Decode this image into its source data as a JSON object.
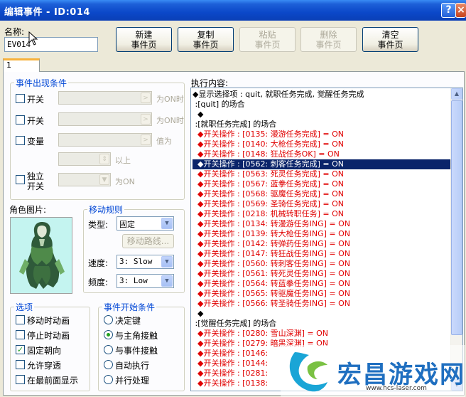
{
  "window": {
    "title": "编辑事件 - ID:014",
    "help_label": "?",
    "close_label": "×"
  },
  "name": {
    "label": "名称:",
    "value": "EV014"
  },
  "toolbar": {
    "new": [
      "新建",
      "事件页"
    ],
    "copy": [
      "复制",
      "事件页"
    ],
    "paste": [
      "粘贴",
      "事件页"
    ],
    "delete": [
      "删除",
      "事件页"
    ],
    "clear": [
      "清空",
      "事件页"
    ]
  },
  "tab": {
    "label": "1"
  },
  "conditions": {
    "legend": "事件出现条件",
    "switch1": {
      "label": "开关",
      "suffix": "为ON时"
    },
    "switch2": {
      "label": "开关",
      "suffix": "为ON时"
    },
    "variable": {
      "label": "变量",
      "suffix": "值为",
      "above": "以上"
    },
    "self_switch": {
      "label_line1": "独立",
      "label_line2": "开关",
      "suffix": "为ON"
    }
  },
  "graphic": {
    "label": "角色图片:"
  },
  "movement": {
    "legend": "移动规则",
    "type_label": "类型:",
    "type_value": "固定",
    "route_button": "移动路线...",
    "speed_label": "速度:",
    "speed_value": "3: Slow",
    "freq_label": "频度:",
    "freq_value": "3: Low"
  },
  "options": {
    "legend": "选项",
    "items": [
      {
        "label": "移动时动画",
        "checked": false
      },
      {
        "label": "停止时动画",
        "checked": false
      },
      {
        "label": "固定朝向",
        "checked": true
      },
      {
        "label": "允许穿透",
        "checked": false
      },
      {
        "label": "在最前面显示",
        "checked": false
      }
    ]
  },
  "trigger": {
    "legend": "事件开始条件",
    "items": [
      {
        "label": "决定键",
        "selected": false
      },
      {
        "label": "与主角接触",
        "selected": true
      },
      {
        "label": "与事件接触",
        "selected": false
      },
      {
        "label": "自动执行",
        "selected": false
      },
      {
        "label": "并行处理",
        "selected": false
      }
    ]
  },
  "exec": {
    "label": "执行内容:",
    "lines": [
      {
        "text": "◆显示选择项 : quit, 就职任务完成, 觉醒任务完成",
        "color": "black"
      },
      {
        "text": " :[quit] 的场合",
        "color": "black"
      },
      {
        "text": "  ◆",
        "color": "black"
      },
      {
        "text": " :[就职任务完成] 的场合",
        "color": "black"
      },
      {
        "text": "  ◆开关操作 : [0135: 漫游任务完成] = ON",
        "color": "red"
      },
      {
        "text": "  ◆开关操作 : [0140: 大枪任务完成] = ON",
        "color": "red"
      },
      {
        "text": "  ◆开关操作 : [0148: 狂战任务OK] = ON",
        "color": "red"
      },
      {
        "text": "  ◆开关操作 : [0562: 刺客任务完成] = ON",
        "color": "selected"
      },
      {
        "text": "  ◆开关操作 : [0563: 死灵任务完成] = ON",
        "color": "red"
      },
      {
        "text": "  ◆开关操作 : [0567: 蓝拳任务完成] = ON",
        "color": "red"
      },
      {
        "text": "  ◆开关操作 : [0568: 驱魔任务完成] = ON",
        "color": "red"
      },
      {
        "text": "  ◆开关操作 : [0569: 圣骑任务完成] = ON",
        "color": "red"
      },
      {
        "text": "  ◆开关操作 : [0218: 机械转职任务] = ON",
        "color": "red"
      },
      {
        "text": "  ◆开关操作 : [0134: 转漫游任务ING] = ON",
        "color": "red"
      },
      {
        "text": "  ◆开关操作 : [0139: 转大枪任务ING] = ON",
        "color": "red"
      },
      {
        "text": "  ◆开关操作 : [0142: 转弹药任务ING] = ON",
        "color": "red"
      },
      {
        "text": "  ◆开关操作 : [0147: 转狂战任务ING] = ON",
        "color": "red"
      },
      {
        "text": "  ◆开关操作 : [0560: 转刺客任务ING] = ON",
        "color": "red"
      },
      {
        "text": "  ◆开关操作 : [0561: 转死灵任务ING] = ON",
        "color": "red"
      },
      {
        "text": "  ◆开关操作 : [0564: 转蓝拳任务ING] = ON",
        "color": "red"
      },
      {
        "text": "  ◆开关操作 : [0565: 转驱魔任务ING] = ON",
        "color": "red"
      },
      {
        "text": "  ◆开关操作 : [0566: 转圣骑任务ING] = ON",
        "color": "red"
      },
      {
        "text": "  ◆",
        "color": "black"
      },
      {
        "text": " :[觉醒任务完成] 的场合",
        "color": "black"
      },
      {
        "text": "  ◆开关操作 : [0280: 雪山深渊] = ON",
        "color": "red"
      },
      {
        "text": "  ◆开关操作 : [0279: 暗黑深渊] = ON",
        "color": "red"
      },
      {
        "text": "  ◆开关操作 : [0146:",
        "color": "red"
      },
      {
        "text": "  ◆开关操作 : [0144:",
        "color": "red"
      },
      {
        "text": "  ◆开关操作 : [0281:",
        "color": "red"
      },
      {
        "text": "  ◆开关操作 : [0138:",
        "color": "red"
      }
    ]
  },
  "watermark": {
    "brand": "宏昌游戏网",
    "url": "www.hcs-laser.com"
  },
  "colors": {
    "selection": "#0a246a",
    "command_red": "#e00000",
    "titlebar": "#0b48c9",
    "legend_blue": "#0046d5"
  }
}
